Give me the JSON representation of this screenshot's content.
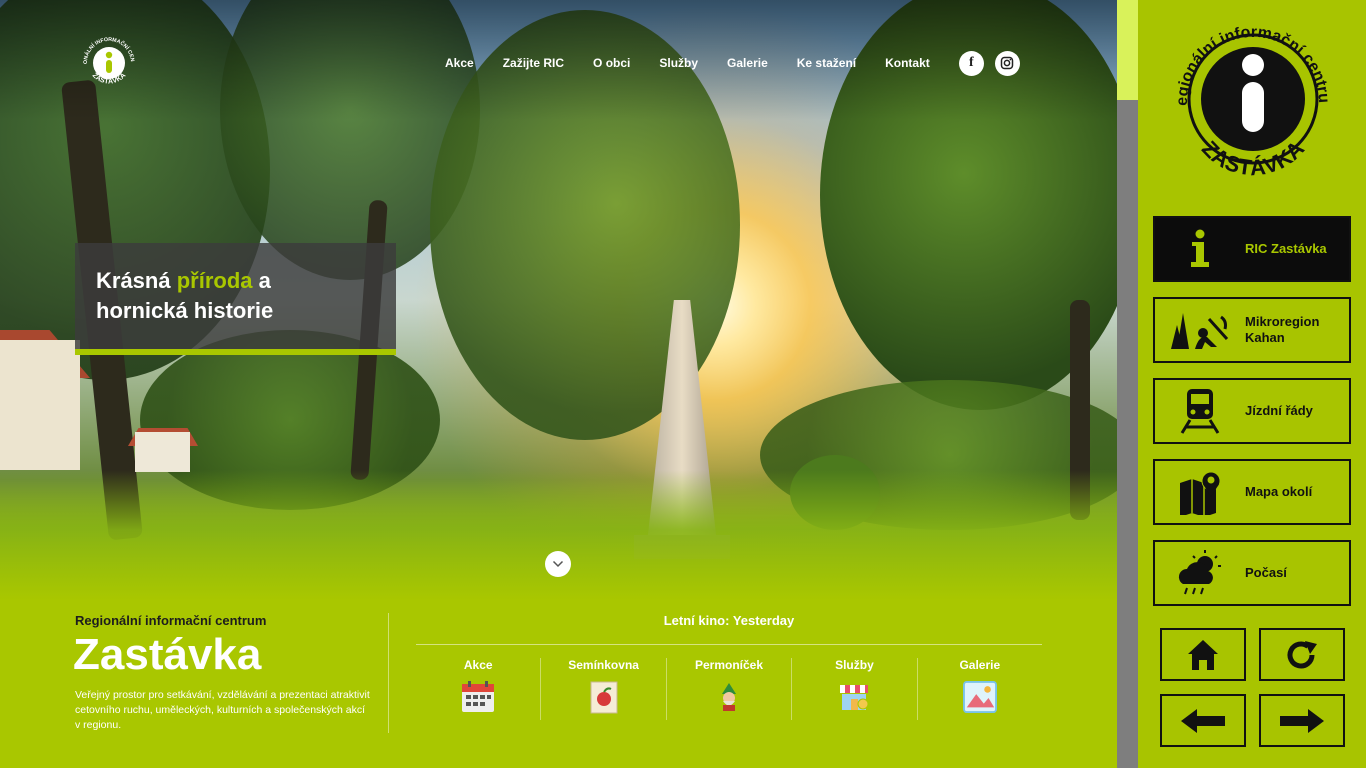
{
  "site": {
    "logo_text_top": "REGIONÁLNÍ INFORMAČNÍ CENTRUM",
    "logo_text_bottom": "ZASTÁVKA",
    "nav": [
      "Akce",
      "Zažijte RIC",
      "O obci",
      "Služby",
      "Galerie",
      "Ke stažení",
      "Kontakt"
    ],
    "social": [
      {
        "icon": "facebook-icon",
        "label": "f"
      },
      {
        "icon": "instagram-icon"
      }
    ],
    "headline": {
      "line1_pre": "Krásná ",
      "line1_accent": "příroda",
      "line1_post": " a",
      "line2": "hornická historie"
    },
    "info": {
      "subtitle": "Regionální informační centrum",
      "title": "Zastávka",
      "description": "Veřejný prostor pro setkávání, vzdělávání a prezentaci atraktivit cetovního ruchu, uměleckých, kulturních a společenských akcí v regionu."
    },
    "cinema": "Letní kino: Yesterday",
    "quick_links": [
      {
        "label": "Akce",
        "icon": "calendar-icon"
      },
      {
        "label": "Semínkovna",
        "icon": "seed-packet-icon"
      },
      {
        "label": "Permoníček",
        "icon": "dwarf-icon"
      },
      {
        "label": "Služby",
        "icon": "shop-icon"
      },
      {
        "label": "Galerie",
        "icon": "picture-icon"
      }
    ]
  },
  "kiosk": {
    "logo_text_top": "Regionální informační centrum",
    "logo_text_bottom": "ZASTÁVKA",
    "buttons": [
      {
        "label": "RIC Zastávka",
        "icon": "info-icon",
        "active": true
      },
      {
        "label": "Mikroregion Kahan",
        "icon": "miner-icon",
        "active": false
      },
      {
        "label": "Jízdní řády",
        "icon": "train-icon",
        "active": false
      },
      {
        "label": "Mapa okolí",
        "icon": "map-pin-icon",
        "active": false
      },
      {
        "label": "Počasí",
        "icon": "weather-icon",
        "active": false
      }
    ],
    "nav_buttons": [
      "home-icon",
      "refresh-icon",
      "arrow-left-icon",
      "arrow-right-icon"
    ]
  },
  "colors": {
    "accent": "#a9c700",
    "dark": "#0c0c0c",
    "kiosk_bg": "#a8c400"
  }
}
